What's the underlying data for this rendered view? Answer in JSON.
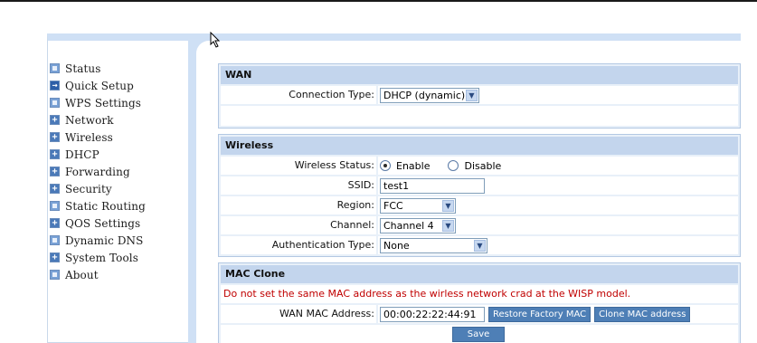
{
  "sidebar": {
    "items": [
      {
        "label": "Status",
        "icon": "page"
      },
      {
        "label": "Quick Setup",
        "icon": "arrow"
      },
      {
        "label": "WPS Settings",
        "icon": "page"
      },
      {
        "label": "Network",
        "icon": "plus"
      },
      {
        "label": "Wireless",
        "icon": "plus"
      },
      {
        "label": "DHCP",
        "icon": "plus"
      },
      {
        "label": "Forwarding",
        "icon": "plus"
      },
      {
        "label": "Security",
        "icon": "plus"
      },
      {
        "label": "Static Routing",
        "icon": "page"
      },
      {
        "label": "QOS Settings",
        "icon": "plus"
      },
      {
        "label": "Dynamic DNS",
        "icon": "page"
      },
      {
        "label": "System Tools",
        "icon": "plus"
      },
      {
        "label": "About",
        "icon": "page"
      }
    ]
  },
  "wan": {
    "title": "WAN",
    "connection_type_label": "Connection Type:",
    "connection_type_value": "DHCP (dynamic)"
  },
  "wireless": {
    "title": "Wireless",
    "status_label": "Wireless Status:",
    "enable_label": "Enable",
    "disable_label": "Disable",
    "ssid_label": "SSID:",
    "ssid_value": "test1",
    "region_label": "Region:",
    "region_value": "FCC",
    "channel_label": "Channel:",
    "channel_value": "Channel 4",
    "auth_label": "Authentication Type:",
    "auth_value": "None"
  },
  "mac_clone": {
    "title": "MAC Clone",
    "note": "Do not set the same MAC address as the wirless network crad at the WISP model.",
    "wan_mac_label": "WAN MAC Address:",
    "wan_mac_value": "00:00:22:22:44:91",
    "restore_button": "Restore Factory MAC",
    "clone_button": "Clone MAC address",
    "save_button": "Save"
  },
  "colors": {
    "accent": "#4e7fb6",
    "section_header": "#c3d5ed",
    "warning": "#c00000"
  }
}
